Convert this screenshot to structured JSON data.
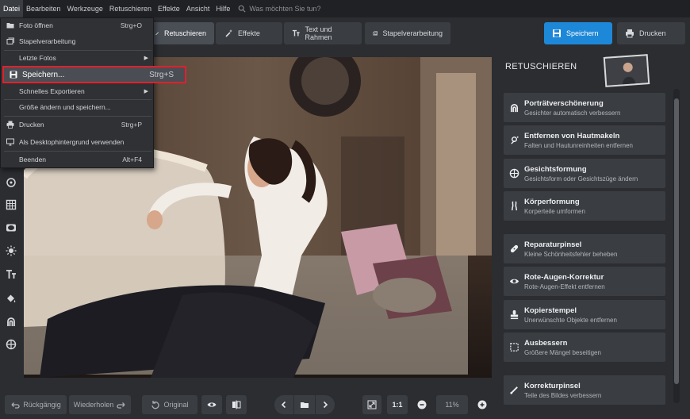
{
  "menubar": {
    "items": [
      "Datei",
      "Bearbeiten",
      "Werkzeuge",
      "Retuschieren",
      "Effekte",
      "Ansicht",
      "Hilfe"
    ],
    "search_placeholder": "Was möchten Sie tun?"
  },
  "toolbar": {
    "retouch": "Retuschieren",
    "effects": "Effekte",
    "text_frames": "Text und Rahmen",
    "batch": "Stapelverarbeitung",
    "save": "Speichern",
    "print": "Drucken"
  },
  "file_menu": {
    "open": {
      "label": "Foto öffnen",
      "shortcut": "Strg+O"
    },
    "batch": {
      "label": "Stapelverarbeitung"
    },
    "recent": {
      "label": "Letzte Fotos"
    },
    "save": {
      "label": "Speichern...",
      "shortcut": "Strg+S"
    },
    "quick_export": {
      "label": "Schnelles Exportieren"
    },
    "resize_save": {
      "label": "Größe ändern und speichern..."
    },
    "print": {
      "label": "Drucken",
      "shortcut": "Strg+P"
    },
    "wallpaper": {
      "label": "Als Desktophintergrund verwenden"
    },
    "exit": {
      "label": "Beenden",
      "shortcut": "Alt+F4"
    }
  },
  "right_panel": {
    "title": "RETUSCHIEREN",
    "cards": [
      {
        "title": "Porträtverschönerung",
        "subtitle": "Gesichter automatisch verbessern",
        "icon": "portrait-icon"
      },
      {
        "title": "Entfernen von Hautmakeln",
        "subtitle": "Falten und Hautunreinheiten entfernen",
        "icon": "skin-icon"
      },
      {
        "title": "Gesichtsformung",
        "subtitle": "Gesichtsform oder Gesichtszüge ändern",
        "icon": "face-shape-icon"
      },
      {
        "title": "Körperformung",
        "subtitle": "Korperteile umformen",
        "icon": "body-icon"
      },
      {
        "title": "Reparaturpinsel",
        "subtitle": "Kleine Schönheitsfehler beheben",
        "icon": "bandage-icon"
      },
      {
        "title": "Rote-Augen-Korrektur",
        "subtitle": "Rote-Augen-Effekt entfernen",
        "icon": "eye-icon"
      },
      {
        "title": "Kopierstempel",
        "subtitle": "Unerwünschte Objekte entfernen",
        "icon": "stamp-icon"
      },
      {
        "title": "Ausbessern",
        "subtitle": "Größere Mängel beseitigen",
        "icon": "patch-icon"
      },
      {
        "title": "Korrekturpinsel",
        "subtitle": "Teile des Bildes verbessern",
        "icon": "brush-icon"
      }
    ]
  },
  "bottombar": {
    "undo": "Rückgängig",
    "redo": "Wiederholen",
    "original": "Original",
    "ratio": "1:1",
    "zoom": "11%"
  },
  "colors": {
    "accent": "#1e88d8",
    "highlight_border": "#e0212b",
    "background": "#2b2d31"
  }
}
